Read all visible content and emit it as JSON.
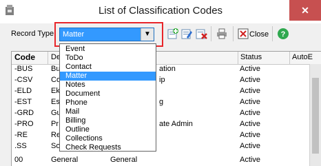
{
  "window": {
    "title": "List of Classification Codes",
    "close_glyph": "✕"
  },
  "toolbar": {
    "record_type_label": "Record Type",
    "record_type_value": "Matter",
    "close_label": "Close",
    "buttons": [
      "add-record-icon",
      "edit-record-icon",
      "delete-record-icon",
      "print-icon",
      "close-icon",
      "help-icon"
    ]
  },
  "dropdown": {
    "options": [
      "Event",
      "ToDo",
      "Contact",
      "Matter",
      "Notes",
      "Document",
      "Phone",
      "Mail",
      "Billing",
      "Outline",
      "Collections",
      "Check Requests"
    ],
    "selected": "Matter"
  },
  "grid": {
    "columns": [
      "Code",
      "De",
      "Status",
      "AutoE"
    ],
    "rows": [
      {
        "code": "-BUS",
        "desc": "Bu",
        "desc2": "ation",
        "status": "Active"
      },
      {
        "code": "-CSV",
        "desc": "Co",
        "desc2": "ip",
        "status": "Active"
      },
      {
        "code": "-ELD",
        "desc": "Ek",
        "desc2": "",
        "status": "Active"
      },
      {
        "code": "-EST",
        "desc": "Es",
        "desc2": "g",
        "status": "Active"
      },
      {
        "code": "-GRD",
        "desc": "Gu",
        "desc2": "",
        "status": "Active"
      },
      {
        "code": "-PRO",
        "desc": "Pr",
        "desc2": "ate Admin",
        "status": "Active"
      },
      {
        "code": "-RE",
        "desc": "Re",
        "desc2": "",
        "status": "Active"
      },
      {
        "code": ".SS",
        "desc": "Soc Sec",
        "desc2": "",
        "status": "Active"
      },
      {
        "code": "00",
        "desc": "General",
        "desc2": "General",
        "status": "Active"
      }
    ]
  },
  "colors": {
    "accent": "#3399ff",
    "highlight_box": "#e8252a",
    "close_button": "#c75050"
  }
}
